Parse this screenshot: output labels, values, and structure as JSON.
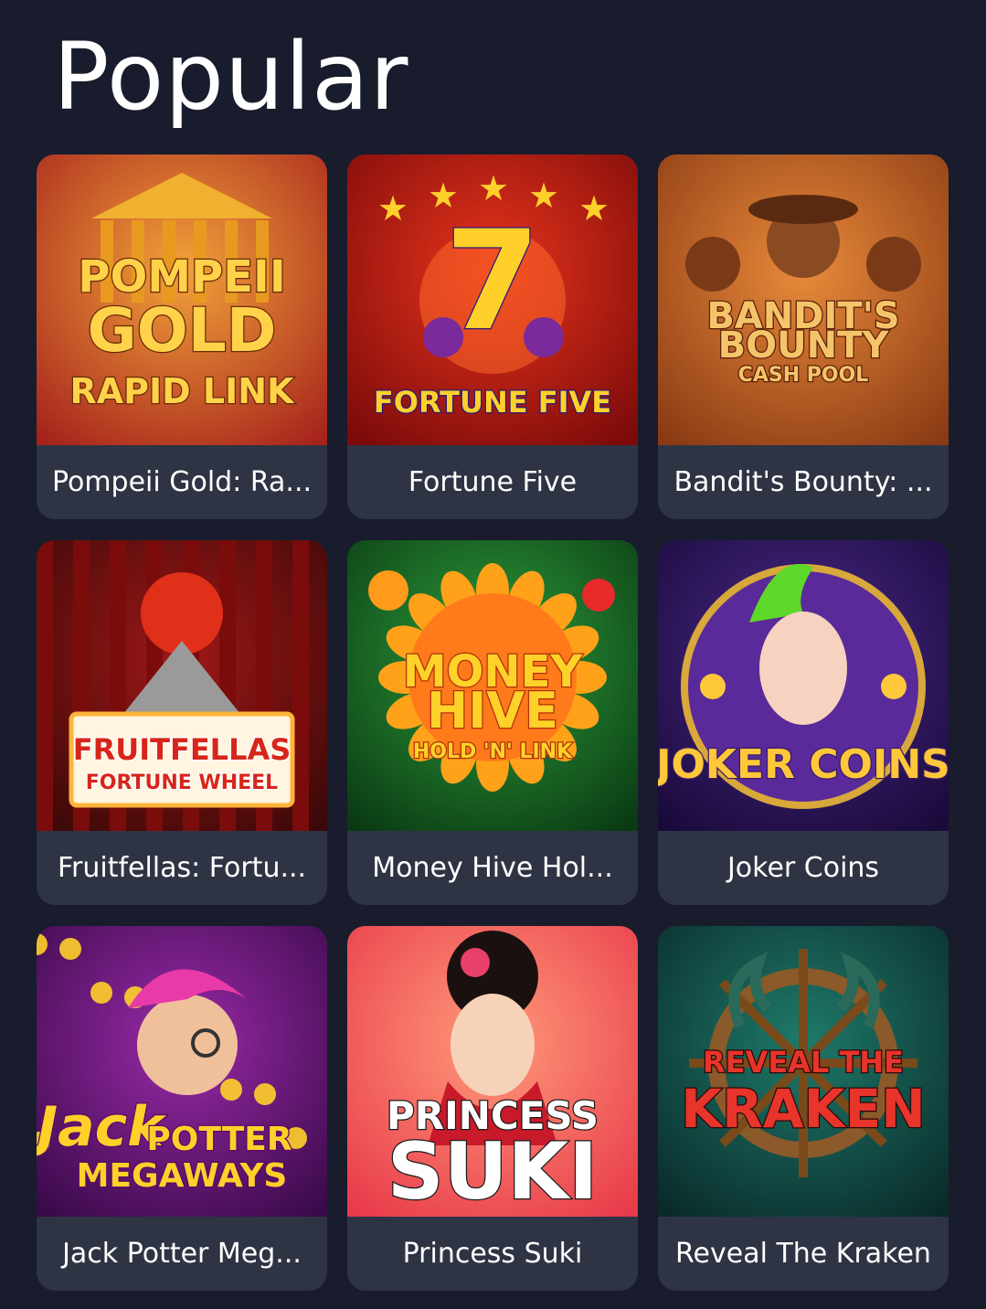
{
  "section": {
    "title": "Popular"
  },
  "games": [
    {
      "caption": "Pompeii Gold: Ra...",
      "art_lines": [
        "POMPEII",
        "GOLD",
        "RAPID LINK"
      ],
      "art": "temple",
      "colors": {
        "bg1": "#f2a23a",
        "bg2": "#a6231c",
        "text": "#ffd24a",
        "stroke": "#6a2a08"
      }
    },
    {
      "caption": "Fortune Five",
      "art_lines": [
        "7",
        "FORTUNE FIVE"
      ],
      "art": "seven",
      "colors": {
        "bg1": "#e8341c",
        "bg2": "#7a0a0a",
        "text": "#ffd02a",
        "stroke": "#2a1a7a"
      }
    },
    {
      "caption": "Bandit's Bounty: ...",
      "art_lines": [
        "BANDIT'S",
        "BOUNTY",
        "CASH POOL"
      ],
      "art": "bandits",
      "colors": {
        "bg1": "#e88a3a",
        "bg2": "#8a3a14",
        "text": "#f5c46a",
        "stroke": "#5a2008"
      }
    },
    {
      "caption": "Fruitfellas: Fortu...",
      "art_lines": [
        "FRUITFELLAS",
        "FORTUNE WHEEL"
      ],
      "art": "fruitfellas",
      "colors": {
        "bg1": "#a01818",
        "bg2": "#3a0808",
        "text": "#d8251a",
        "stroke": "#ffffff"
      }
    },
    {
      "caption": "Money Hive Hol...",
      "art_lines": [
        "MONEY",
        "HIVE",
        "HOLD 'N' LINK"
      ],
      "art": "sunflower",
      "colors": {
        "bg1": "#2e9e3a",
        "bg2": "#0a3a14",
        "text": "#ffd22a",
        "stroke": "#b0300a"
      }
    },
    {
      "caption": "Joker Coins",
      "art_lines": [
        "JOKER COINS"
      ],
      "art": "joker",
      "colors": {
        "bg1": "#4a2a8a",
        "bg2": "#1a0a3a",
        "text": "#ffc83a",
        "stroke": "#3a1a6a"
      }
    },
    {
      "caption": "Jack Potter Meg...",
      "art_lines": [
        "Jack",
        "POTTER",
        "MEGAWAYS"
      ],
      "art": "jester",
      "colors": {
        "bg1": "#9a2aa8",
        "bg2": "#3a0a4a",
        "text": "#ffd02a",
        "stroke": "#5a0a6a"
      }
    },
    {
      "caption": "Princess Suki",
      "art_lines": [
        "PRINCESS",
        "SUKI"
      ],
      "art": "princess",
      "colors": {
        "bg1": "#ff9a7a",
        "bg2": "#e83a4a",
        "text": "#ffffff",
        "stroke": "#1a1a1a"
      }
    },
    {
      "caption": "Reveal The Kraken",
      "art_lines": [
        "REVEAL THE",
        "KRAKEN"
      ],
      "art": "kraken",
      "colors": {
        "bg1": "#1e7a6a",
        "bg2": "#0a2a2a",
        "text": "#e8342a",
        "stroke": "#2a0a0a"
      }
    }
  ]
}
